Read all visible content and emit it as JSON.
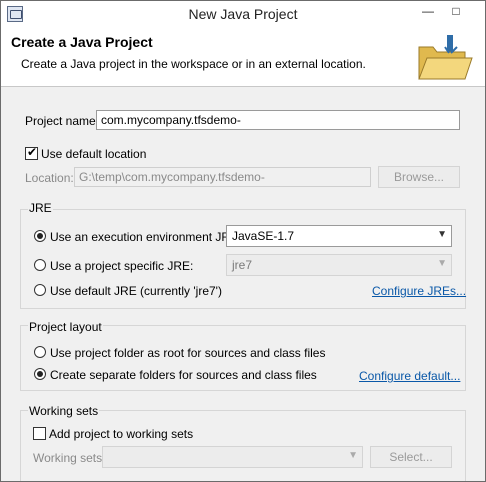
{
  "window": {
    "title": "New Java Project",
    "minimize_glyph": "—",
    "maximize_glyph": "□"
  },
  "banner": {
    "title": "Create a Java Project",
    "description": "Create a Java project in the workspace or in an external location.",
    "icon": "folder-icon"
  },
  "project": {
    "name_label": "Project name:",
    "name_value": "com.mycompany.tfsdemo-",
    "use_default_label": "Use default location",
    "use_default_checked": true,
    "location_label": "Location:",
    "location_value": "G:\\temp\\com.mycompany.tfsdemo-",
    "browse_label": "Browse..."
  },
  "jre": {
    "title": "JRE",
    "options": [
      {
        "label": "Use an execution environment JRE:",
        "selected": true,
        "select_value": "JavaSE-1.7"
      },
      {
        "label": "Use a project specific JRE:",
        "selected": false,
        "select_value": "jre7"
      },
      {
        "label": "Use default JRE (currently 'jre7')",
        "selected": false
      }
    ],
    "configure_link": "Configure JREs..."
  },
  "layout": {
    "title": "Project layout",
    "options": [
      {
        "label": "Use project folder as root for sources and class files",
        "selected": false
      },
      {
        "label": "Create separate folders for sources and class files",
        "selected": true
      }
    ],
    "configure_link": "Configure default..."
  },
  "working_sets": {
    "title": "Working sets",
    "add_label": "Add project to working sets",
    "add_checked": false,
    "sets_label": "Working sets:",
    "select_label": "Select..."
  }
}
